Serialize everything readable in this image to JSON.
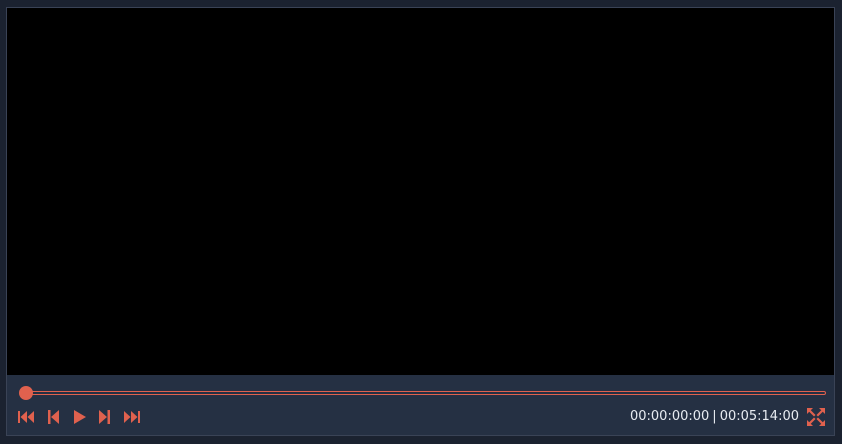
{
  "player": {
    "current_time": "00:00:00:00",
    "separator": "|",
    "total_duration": "00:05:14:00",
    "progress": 0.0
  },
  "controls": {
    "skip_start_icon": "skip-to-start-icon",
    "prev_frame_icon": "previous-frame-icon",
    "play_icon": "play-icon",
    "next_frame_icon": "next-frame-icon",
    "skip_end_icon": "skip-to-end-icon",
    "fullscreen_icon": "fullscreen-icon"
  },
  "colors": {
    "accent": "#e0614e",
    "control_bar": "#253043",
    "video_background": "#000000",
    "page_background": "#1b2230",
    "timecode_text": "#e8ecf2"
  }
}
